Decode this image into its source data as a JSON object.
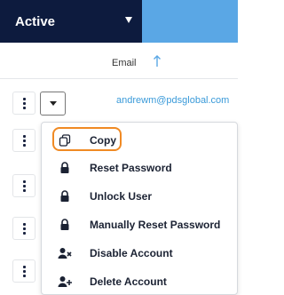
{
  "header": {
    "status_filter": "Active"
  },
  "table": {
    "columns": {
      "email": "Email"
    },
    "rows": [
      {
        "email": "andrewm@pdsglobal.com"
      }
    ]
  },
  "context_menu": {
    "items": [
      {
        "label": "Copy",
        "icon": "copy-icon"
      },
      {
        "label": "Reset Password",
        "icon": "lock-icon"
      },
      {
        "label": "Unlock User",
        "icon": "lock-icon"
      },
      {
        "label": "Manually Reset Password",
        "icon": "lock-icon"
      },
      {
        "label": "Disable Account",
        "icon": "user-remove-icon"
      },
      {
        "label": "Delete Account",
        "icon": "user-add-icon"
      }
    ]
  },
  "colors": {
    "header_dark": "#0d1b3e",
    "header_light": "#5aa7e5",
    "link": "#3a9ad9",
    "highlight": "#f08a24"
  }
}
